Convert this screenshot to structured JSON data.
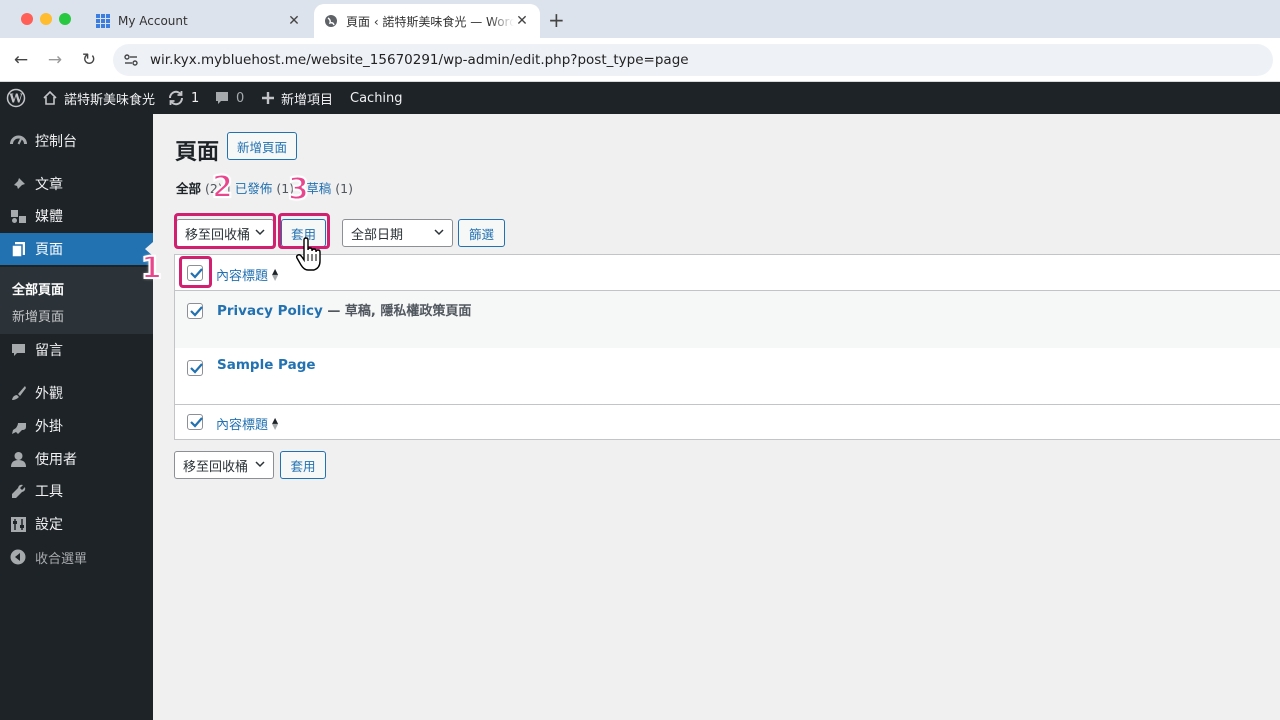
{
  "browser": {
    "tabs": [
      {
        "title": "My Account",
        "icon": "grid-icon"
      },
      {
        "title": "頁面 ‹ 諾特斯美味食光 — WordPress",
        "icon": "globe-icon",
        "active": true
      }
    ],
    "url": "wir.kyx.mybluehost.me/website_15670291/wp-admin/edit.php?post_type=page",
    "colors": {
      "tabbar": "#dde3ec",
      "address": "#eef1f6"
    }
  },
  "adminbar": {
    "site_name": "諾特斯美味食光",
    "updates_count": "1",
    "comments_count": "0",
    "new_label": "新增項目",
    "caching_label": "Caching"
  },
  "sidebar": {
    "items": [
      {
        "label": "控制台",
        "icon": "dashboard-icon"
      },
      {
        "label": "文章",
        "icon": "pin-icon"
      },
      {
        "label": "媒體",
        "icon": "media-icon"
      },
      {
        "label": "頁面",
        "icon": "page-icon",
        "current": true
      },
      {
        "label": "留言",
        "icon": "comment-icon"
      },
      {
        "label": "外觀",
        "icon": "brush-icon"
      },
      {
        "label": "外掛",
        "icon": "plugin-icon"
      },
      {
        "label": "使用者",
        "icon": "user-icon"
      },
      {
        "label": "工具",
        "icon": "wrench-icon"
      },
      {
        "label": "設定",
        "icon": "settings-icon"
      }
    ],
    "submenu": {
      "all_pages": "全部頁面",
      "add_new": "新增頁面"
    },
    "collapse_label": "收合選單"
  },
  "page": {
    "title": "頁面",
    "add_new": "新增頁面",
    "views": {
      "all": "全部",
      "all_count": "(2)",
      "published": "已發佈",
      "published_count": "(1)",
      "drafts": "草稿",
      "drafts_count": "(1)"
    },
    "bulk_action": "移至回收桶",
    "apply": "套用",
    "date_filter": "全部日期",
    "filter": "篩選",
    "column_title": "內容標題",
    "rows": [
      {
        "title": "Privacy Policy",
        "state": " — 草稿, 隱私權政策頁面",
        "checked": true
      },
      {
        "title": "Sample Page",
        "state": "",
        "checked": true
      }
    ]
  },
  "annotations": {
    "step1": "1",
    "step2": "2",
    "step3": "3",
    "color": "#d0206f"
  }
}
